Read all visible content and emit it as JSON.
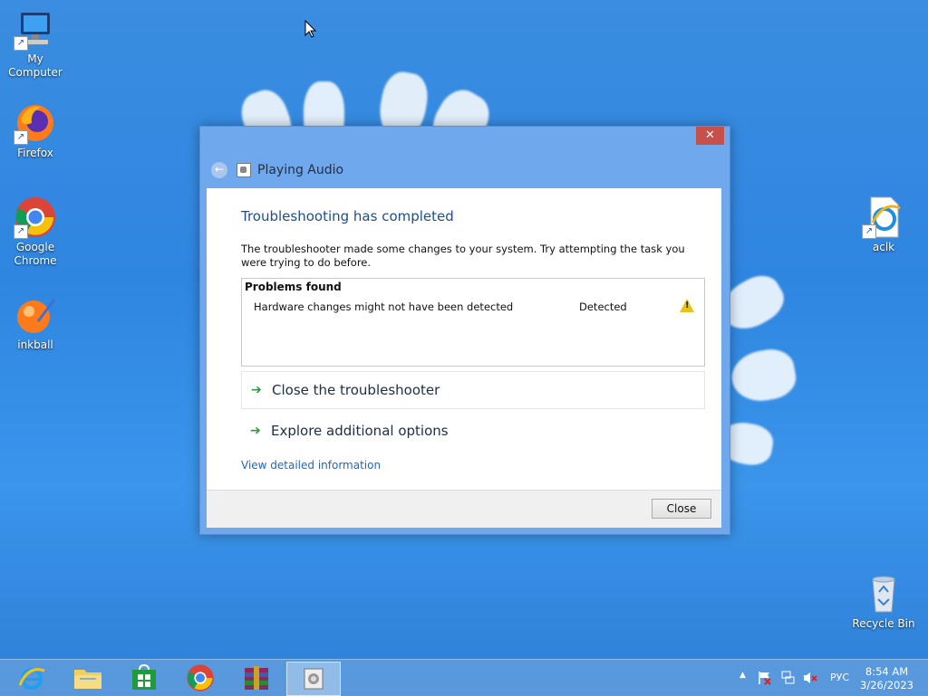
{
  "desktop": {
    "icons_left": [
      {
        "label": "My Computer"
      },
      {
        "label": "Firefox"
      },
      {
        "label": "Google Chrome"
      },
      {
        "label": "inkball"
      }
    ],
    "icons_right": [
      {
        "label": "aclk"
      },
      {
        "label": "Recycle Bin"
      }
    ]
  },
  "dialog": {
    "title": "Playing Audio",
    "close_glyph": "✕",
    "heading": "Troubleshooting has completed",
    "description": "The troubleshooter made some changes to your system. Try attempting the task you were trying to do before.",
    "problems": {
      "header": "Problems found",
      "rows": [
        {
          "name": "Hardware changes might not have been detected",
          "status": "Detected",
          "icon": "warning-icon"
        }
      ]
    },
    "options": [
      {
        "label": "Close the troubleshooter"
      },
      {
        "label": "Explore additional options"
      }
    ],
    "detail_link": "View detailed information",
    "close_button": "Close"
  },
  "taskbar": {
    "apps": [
      "internet-explorer",
      "file-explorer",
      "store",
      "chrome",
      "winrar",
      "troubleshooter"
    ],
    "language": "РУС",
    "time": "8:54 AM",
    "date": "3/26/2023"
  },
  "colors": {
    "desktop_bg": "#3a8de0",
    "dialog_frame": "#6fa8ec",
    "close_red": "#c7504a",
    "heading_blue": "#1e4e8c",
    "link_blue": "#2367b8"
  }
}
